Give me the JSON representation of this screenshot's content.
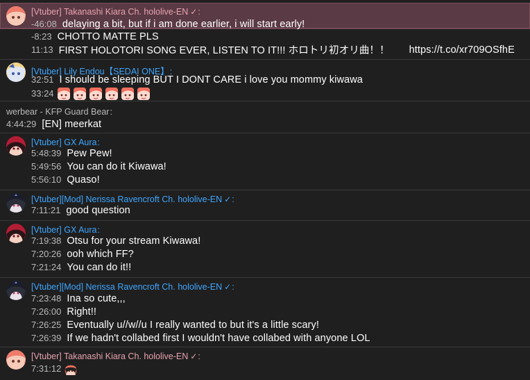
{
  "colors": {
    "background": "#1f1f1f",
    "highlight_row": "#5a3a44",
    "vtuber_kiara_name": "#e8a3b0",
    "vtuber_blue_name": "#3ea6ff",
    "guest_name": "#b9b9b9",
    "timestamp": "#b9b9b9",
    "message_text": "#ffffff"
  },
  "groups": [
    {
      "author": "[Vtuber] Takanashi Kiara Ch. hololive-EN",
      "badge": "✓",
      "colon": ":",
      "avatar_icon": "kiara-avatar-icon",
      "messages": [
        {
          "time": "-46:08",
          "text": "delaying a bit, but if i am done earlier, i will start early!"
        },
        {
          "time": "-8:23",
          "text": "CHOTTO MATTE PLS"
        },
        {
          "time": "11:13",
          "text": "FIRST HOLOTORI SONG EVER, LISTEN TO IT!!! ホロトリ初オリ曲！！",
          "link": "https://t.co/xr709OSfhE"
        }
      ]
    },
    {
      "author": "[Vtuber] Lily Endou【SEDAI ONE】",
      "colon": ":",
      "avatar_icon": "lily-avatar-icon",
      "messages": [
        {
          "time": "32:51",
          "text": "I should be sleeping BUT I DONT CARE i love you mommy kiwawa"
        },
        {
          "time": "33:24",
          "emotes": [
            "kiara-emote-icon",
            "kiara-emote-icon",
            "kiara-emote-icon",
            "kiara-emote-icon",
            "kiara-emote-icon",
            "kiara-emote-icon"
          ]
        }
      ]
    },
    {
      "author": "werbear - KFP Guard Bear",
      "colon": ":",
      "messages": [
        {
          "time": "4:44:29",
          "text": "[EN] meerkat"
        }
      ]
    },
    {
      "author": "[Vtuber] GX Aura",
      "colon": ":",
      "avatar_icon": "aura-avatar-icon",
      "messages": [
        {
          "time": "5:48:39",
          "text": "Pew Pew!"
        },
        {
          "time": "5:49:56",
          "text": "You can do it Kiwawa!"
        },
        {
          "time": "5:56:10",
          "text": "Quaso!"
        }
      ]
    },
    {
      "author": "[Vtuber][Mod] Nerissa Ravencroft Ch. hololive-EN",
      "badge": "✓",
      "colon": ":",
      "avatar_icon": "nerissa-avatar-icon",
      "messages": [
        {
          "time": "7:11:21",
          "text": "good question"
        }
      ]
    },
    {
      "author": "[Vtuber] GX Aura",
      "colon": ":",
      "avatar_icon": "aura-avatar-icon",
      "messages": [
        {
          "time": "7:19:38",
          "text": "Otsu for your stream Kiwawa!"
        },
        {
          "time": "7:20:26",
          "text": "ooh which FF?"
        },
        {
          "time": "7:21:24",
          "text": "You can do it!!"
        }
      ]
    },
    {
      "author": "[Vtuber][Mod] Nerissa Ravencroft Ch. hololive-EN",
      "badge": "✓",
      "colon": ":",
      "avatar_icon": "nerissa-avatar-icon",
      "messages": [
        {
          "time": "7:23:48",
          "text": "Ina so cute,,,"
        },
        {
          "time": "7:26:00",
          "text": "Right!!"
        },
        {
          "time": "7:26:25",
          "text": "Eventually u//w//u I really wanted to but it's a little scary!"
        },
        {
          "time": "7:26:39",
          "text": "If we hadn't collabed first I wouldn't have collabed with anyone LOL"
        }
      ]
    },
    {
      "author": "[Vtuber] Takanashi Kiara Ch. hololive-EN",
      "badge": "✓",
      "colon": ":",
      "avatar_icon": "kiara-avatar-icon",
      "messages": [
        {
          "time": "7:31:12",
          "emotes": [
            "kiara-chibi-emote-icon"
          ]
        }
      ]
    }
  ]
}
